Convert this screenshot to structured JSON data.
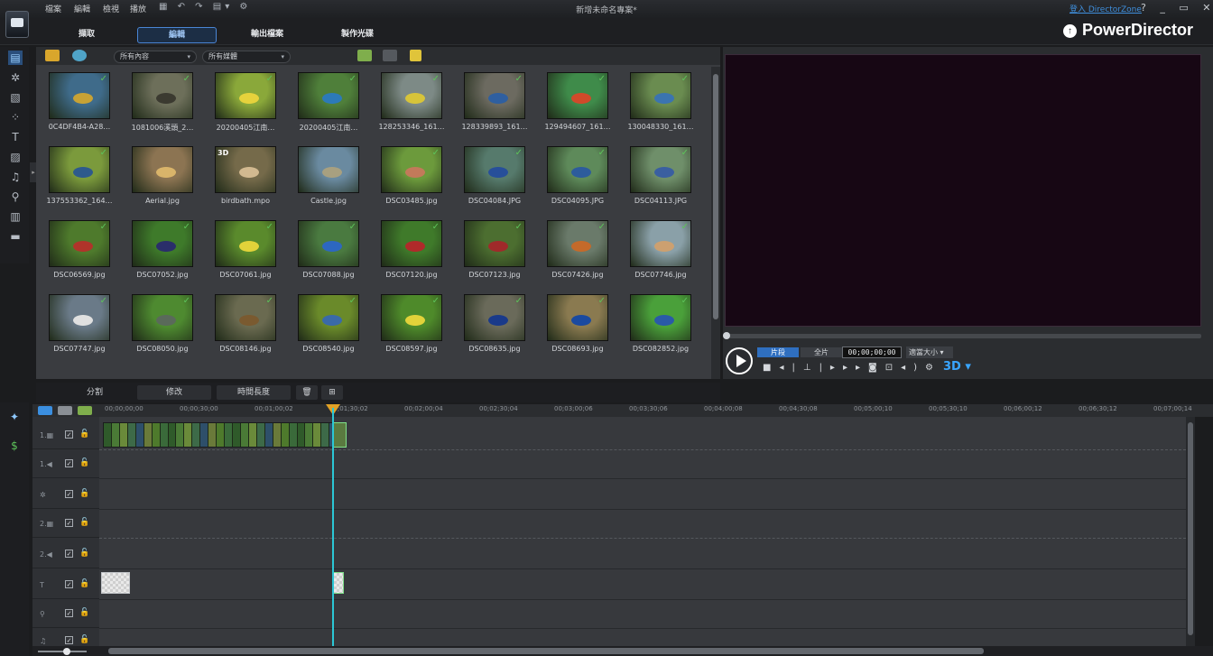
{
  "menubar": {
    "items": [
      "檔案",
      "編輯",
      "檢視",
      "播放"
    ],
    "project_title": "新增未命名專案*",
    "directorzone": "登入 DirectorZone",
    "window_controls": "? _ ▭ ✕"
  },
  "module_tabs": [
    "擷取",
    "編輯",
    "輸出檔案",
    "製作光碟"
  ],
  "active_module": "編輯",
  "brand": "PowerDirector",
  "library": {
    "filter_content": "所有內容",
    "filter_media": "所有媒體",
    "items": [
      "0C4DF4B4-A28…",
      "1081006溪頭_2…",
      "20200405江南…",
      "20200405江南…",
      "128253346_161…",
      "128339893_161…",
      "129494607_161…",
      "130048330_161…",
      "137553362_164…",
      "Aerial.jpg",
      "birdbath.mpo",
      "Castle.jpg",
      "DSC03485.jpg",
      "DSC04084.JPG",
      "DSC04095.JPG",
      "DSC04113.JPG",
      "DSC06569.jpg",
      "DSC07052.jpg",
      "DSC07061.jpg",
      "DSC07088.jpg",
      "DSC07120.jpg",
      "DSC07123.jpg",
      "DSC07426.jpg",
      "DSC07746.jpg",
      "DSC07747.jpg",
      "DSC08050.jpg",
      "DSC08146.jpg",
      "DSC08540.jpg",
      "DSC08597.jpg",
      "DSC08635.jpg",
      "DSC08693.jpg",
      "DSC082852.jpg",
      "",
      "",
      "",
      "",
      "",
      "",
      "",
      ""
    ],
    "badge_3d": "3D"
  },
  "preview": {
    "tab_clip": "片段",
    "tab_movie": "全片",
    "timecode": "00;00;00;00",
    "fit": "適當大小 ▾",
    "btn_3d": "3D ▾"
  },
  "edit_toolbar": {
    "split": "分割",
    "modify": "修改",
    "duration": "時間長度"
  },
  "timeline": {
    "ticks": [
      "00;00;00;00",
      "00;00;30;00",
      "00;01;00;02",
      "00;01;30;02",
      "00;02;00;04",
      "00;02;30;04",
      "00;03;00;06",
      "00;03;30;06",
      "00;04;00;08",
      "00;04;30;08",
      "00;05;00;10",
      "00;05;30;10",
      "00;06;00;12",
      "00;06;30;12",
      "00;07;00;14"
    ],
    "tracks": [
      {
        "label": "1.▦",
        "icon": "video-track-icon"
      },
      {
        "label": "1.◀",
        "icon": "audio-track-icon"
      },
      {
        "label": "✲",
        "icon": "effect-track-icon"
      },
      {
        "label": "2.▦",
        "icon": "video-track-icon"
      },
      {
        "label": "2.◀",
        "icon": "audio-track-icon"
      },
      {
        "label": "T",
        "icon": "title-track-icon"
      },
      {
        "label": "⚲",
        "icon": "voice-track-icon"
      },
      {
        "label": "♫",
        "icon": "music-track-icon"
      }
    ]
  },
  "colors": {
    "accent": "#4a86d6",
    "playhead": "#2bc7d6",
    "check": "#5dc35a",
    "video_bg": "#170714"
  }
}
